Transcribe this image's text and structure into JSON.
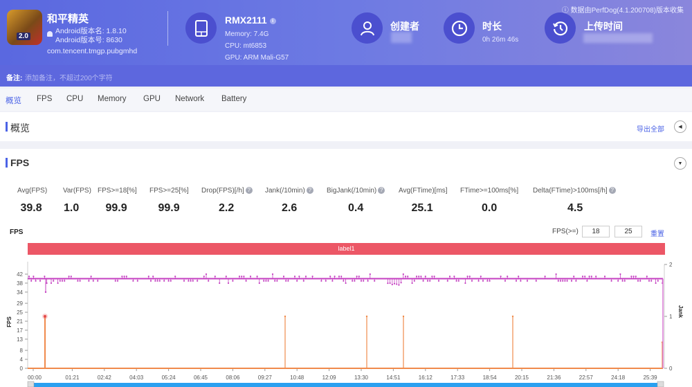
{
  "app": {
    "name": "和平精英",
    "version_name": "Android版本名: 1.8.10",
    "version_code": "Android版本号: 8630",
    "package": "com.tencent.tmgp.pubgmhd",
    "icon_badge": "2.0"
  },
  "device": {
    "model": "RMX2111",
    "memory": "Memory: 7.4G",
    "cpu": "CPU: mt6853",
    "gpu": "GPU: ARM Mali-G57"
  },
  "creator": {
    "title": "创建者"
  },
  "duration": {
    "title": "时长",
    "value": "0h 26m 46s"
  },
  "upload": {
    "title": "上传时间"
  },
  "perfdog_note": "数据由PerfDog(4.1.200708)版本收集",
  "remark": {
    "label": "备注:",
    "placeholder": "添加备注，不超过200个字符"
  },
  "tabs": [
    {
      "label": "概览",
      "active": true
    },
    {
      "label": "FPS"
    },
    {
      "label": "CPU"
    },
    {
      "label": "Memory"
    },
    {
      "label": "GPU"
    },
    {
      "label": "Network"
    },
    {
      "label": "Battery"
    }
  ],
  "overview": {
    "title": "概览",
    "export_label": "导出全部"
  },
  "fps_section": {
    "title": "FPS",
    "metrics": [
      {
        "label": "Avg(FPS)",
        "value": "39.8",
        "help": false
      },
      {
        "label": "Var(FPS)",
        "value": "1.0",
        "help": false
      },
      {
        "label": "FPS>=18[%]",
        "value": "99.9",
        "help": false
      },
      {
        "label": "FPS>=25[%]",
        "value": "99.9",
        "help": false
      },
      {
        "label": "Drop(FPS)[/h]",
        "value": "2.2",
        "help": true
      },
      {
        "label": "Jank(/10min)",
        "value": "2.6",
        "help": true
      },
      {
        "label": "BigJank(/10min)",
        "value": "0.4",
        "help": true
      },
      {
        "label": "Avg(FTime)[ms]",
        "value": "25.1",
        "help": false
      },
      {
        "label": "FTime>=100ms[%]",
        "value": "0.0",
        "help": false
      },
      {
        "label": "Delta(FTime)>100ms[/h]",
        "value": "4.5",
        "help": true
      }
    ],
    "chart_label": "FPS",
    "threshold_label": "FPS(>=)",
    "threshold_low": "18",
    "threshold_high": "25",
    "reset_label": "重置",
    "band_label": "label1"
  },
  "chart_data": {
    "type": "line",
    "title": "FPS",
    "ylabel": "FPS",
    "y2label": "Jank",
    "yticks": [
      0,
      4,
      8,
      13,
      17,
      21,
      25,
      29,
      34,
      38,
      42
    ],
    "ylim": [
      0,
      42
    ],
    "y2ticks": [
      0,
      1,
      2
    ],
    "y2lim": [
      0,
      2
    ],
    "xticks": [
      "00:00",
      "01:21",
      "02:42",
      "04:03",
      "05:24",
      "06:45",
      "08:06",
      "09:27",
      "10:48",
      "12:09",
      "13:30",
      "14:51",
      "16:12",
      "17:33",
      "18:54",
      "20:15",
      "21:36",
      "22:57",
      "24:18",
      "25:39"
    ],
    "duration_seconds": 1606,
    "series": [
      {
        "name": "FPS",
        "color": "#c43fc1",
        "typical_value": 40,
        "range": [
          34,
          42
        ]
      },
      {
        "name": "Jank",
        "color": "#f08a4b",
        "spikes_seconds": [
          30,
          634,
          838,
          930,
          1204,
          1605
        ],
        "spike_value": 1
      }
    ],
    "band": {
      "label": "label1",
      "color": "#ec5766"
    }
  }
}
